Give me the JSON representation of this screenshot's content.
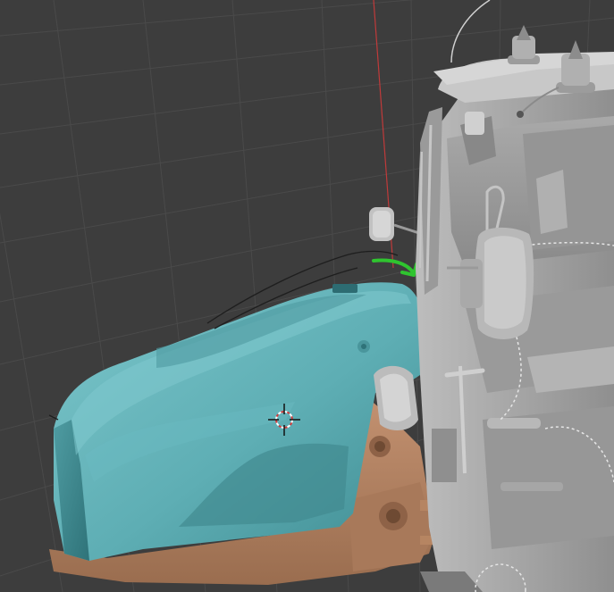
{
  "viewport": {
    "view_mode": "3D viewport",
    "shading": "solid",
    "background_color": "#3d3d3d",
    "grid_color": "#4a4a4a",
    "axis_z_color": "#c03a3a"
  },
  "scene": {
    "objects": [
      {
        "name": "hood",
        "color": "#5eaeb4"
      },
      {
        "name": "cabin",
        "color": "#a4a4a4"
      },
      {
        "name": "chassis",
        "color": "#b98460"
      },
      {
        "name": "side-mirror-left",
        "color": "#c2c2c2"
      },
      {
        "name": "side-mirror-right",
        "color": "#b8b8b8"
      },
      {
        "name": "beacon-light-1",
        "color": "#b0b0b0"
      },
      {
        "name": "beacon-light-2",
        "color": "#b0b0b0"
      },
      {
        "name": "antenna",
        "color": "#d0d0d0"
      }
    ],
    "annotation": {
      "type": "hand-drawn-arrow",
      "color": "#2fc42f"
    },
    "cursor_3d": {
      "name": "3d-cursor"
    }
  }
}
